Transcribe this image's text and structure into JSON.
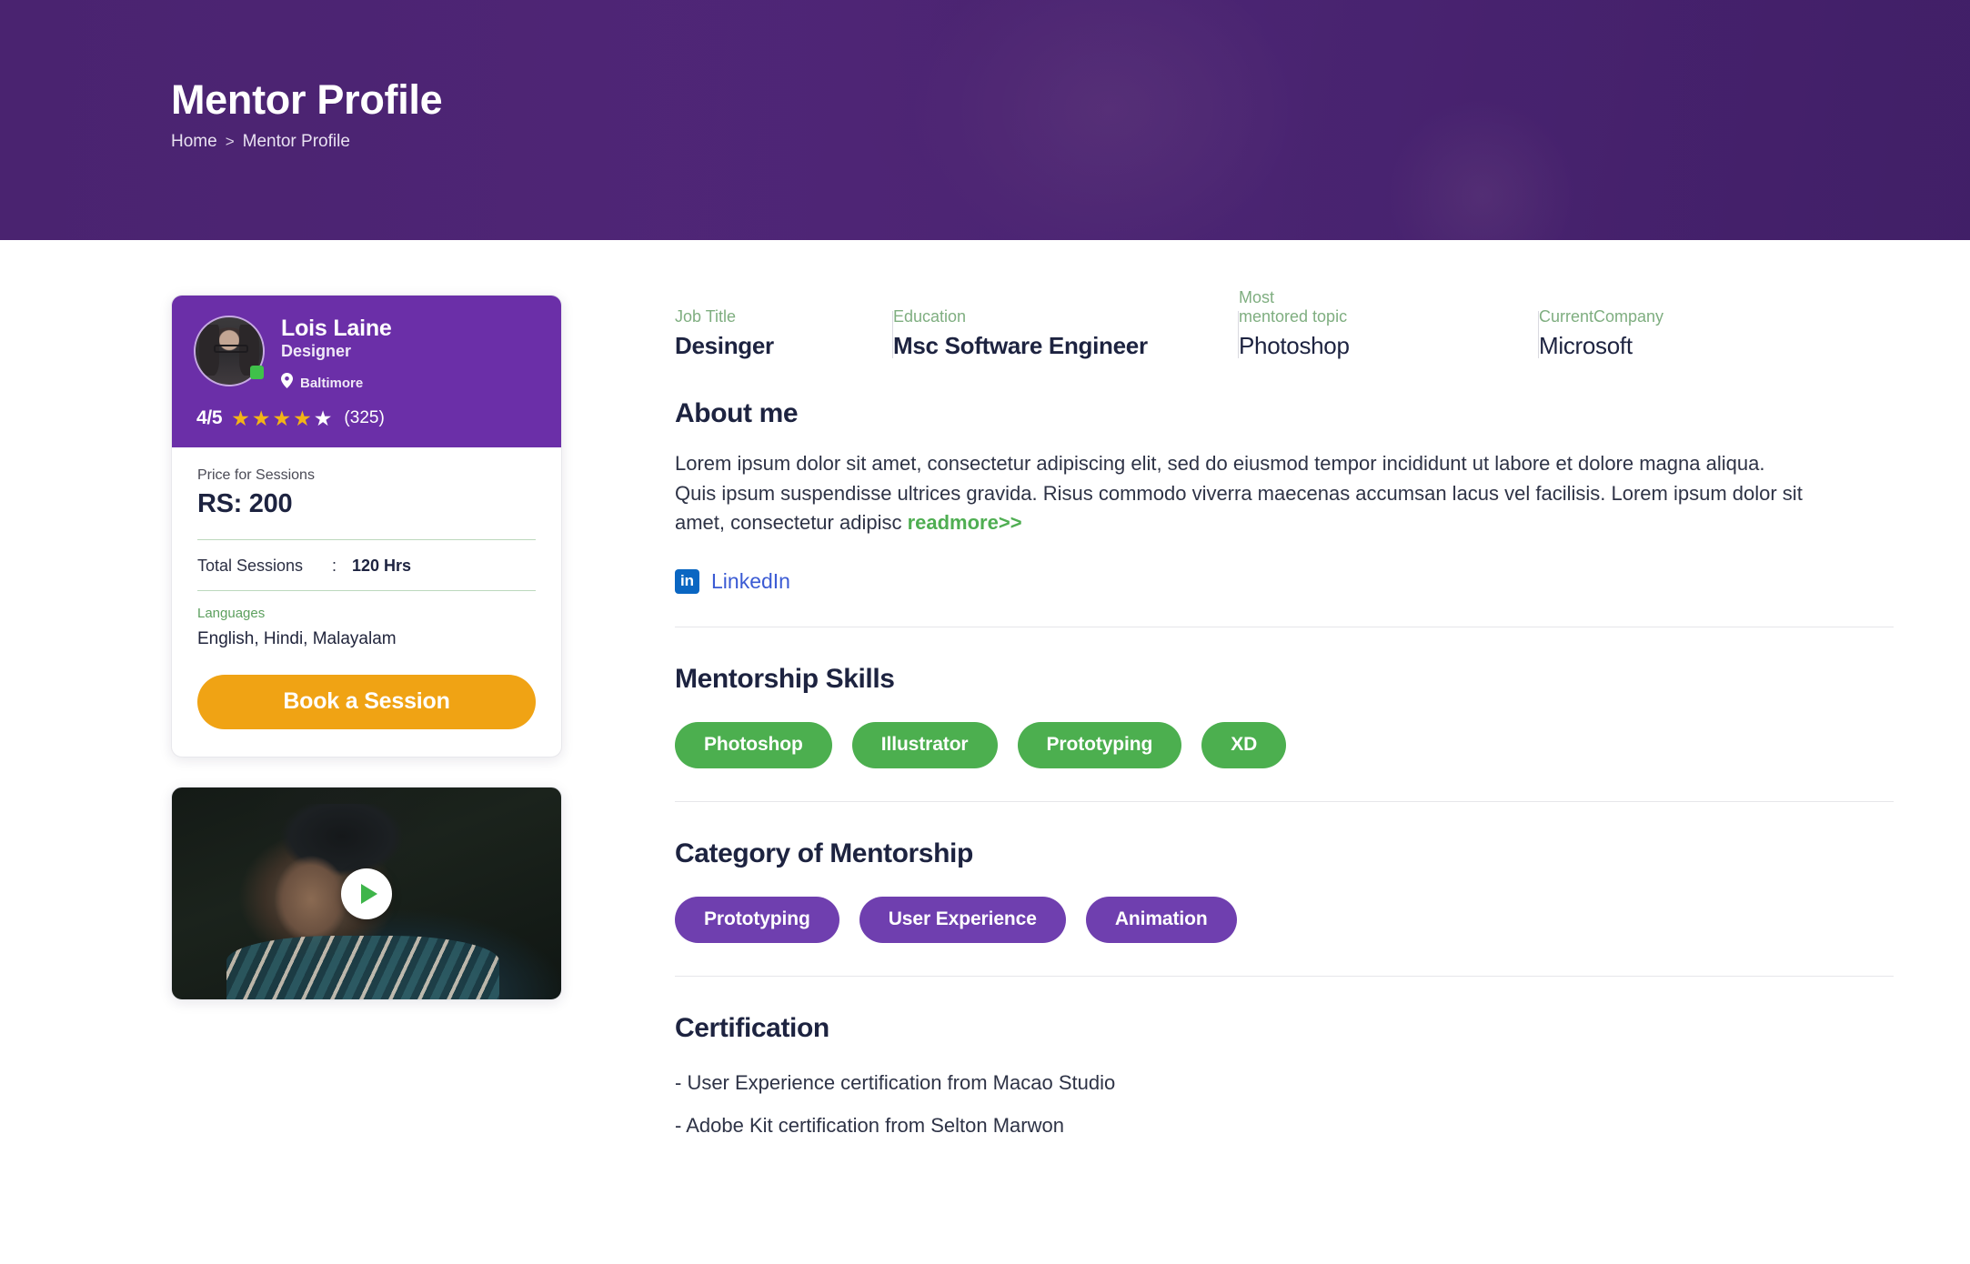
{
  "banner": {
    "title": "Mentor Profile",
    "breadcrumb": {
      "home": "Home",
      "separator": ">",
      "current": "Mentor Profile"
    }
  },
  "profile_card": {
    "name": "Lois Laine",
    "role": "Designer",
    "location": "Baltimore",
    "location_icon": "map-pin-icon",
    "status": "online",
    "rating_value": "4/5",
    "rating_filled_stars": 4,
    "rating_total_stars": 5,
    "rating_count": "(325)",
    "price_label": "Price for Sessions",
    "price_value": "RS: 200",
    "total_sessions_label": "Total Sessions",
    "total_sessions_colon": ":",
    "total_sessions_value": "120 Hrs",
    "languages_label": "Languages",
    "languages_value": "English, Hindi, Malayalam",
    "book_button": "Book a Session"
  },
  "video": {
    "play_icon": "play-icon"
  },
  "stats": [
    {
      "label": "Job Title",
      "value": "Desinger"
    },
    {
      "label": "Education",
      "value": "Msc Software Engineer"
    },
    {
      "label": "Most\nmentored topic",
      "value": "Photoshop"
    },
    {
      "label": "CurrentCompany",
      "value": "Microsoft"
    }
  ],
  "about": {
    "title": "About me",
    "text": "Lorem ipsum dolor sit amet, consectetur adipiscing elit, sed do eiusmod tempor incididunt ut labore et dolore magna aliqua. Quis ipsum suspendisse ultrices gravida. Risus commodo viverra maecenas accumsan lacus vel facilisis. Lorem ipsum dolor sit amet, consectetur adipisc ",
    "readmore": "readmore>>"
  },
  "linkedin": {
    "icon_text": "in",
    "label": "LinkedIn"
  },
  "skills": {
    "title": "Mentorship Skills",
    "items": [
      "Photoshop",
      "Illustrator",
      "Prototyping",
      "XD"
    ]
  },
  "category": {
    "title": "Category of Mentorship",
    "items": [
      "Prototyping",
      "User Experience",
      "Animation"
    ]
  },
  "certification": {
    "title": "Certification",
    "items": [
      "- User Experience certification from Macao Studio",
      "- Adobe Kit certification from Selton Marwon"
    ]
  },
  "colors": {
    "banner_purple": "#4b2472",
    "card_purple": "#6b2fa8",
    "pill_purple": "#6f3faf",
    "pill_green": "#4caf4f",
    "button_orange": "#f0a314",
    "star_gold": "#f3b416",
    "link_blue": "#3b5bd4",
    "linkedin_blue": "#0a66c2",
    "label_green": "#7fae80",
    "readmore_green": "#4fae52",
    "heading_navy": "#1d2340"
  }
}
